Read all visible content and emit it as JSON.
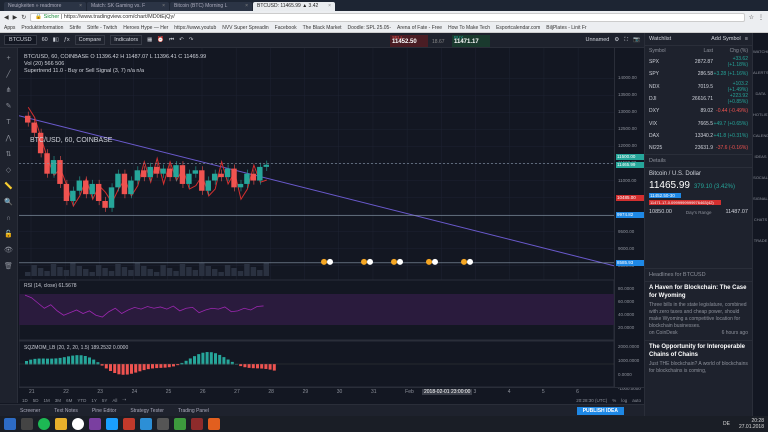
{
  "browser": {
    "tabs": [
      {
        "label": "Neuigkeiten » readmore",
        "active": false
      },
      {
        "label": "Match: SK Gaming vs. F",
        "active": false
      },
      {
        "label": "Bitcoin (BTC) Morning L",
        "active": false
      },
      {
        "label": "BTCUSD: 11465.99 ▲ 3.42",
        "active": true
      }
    ],
    "secure_label": "Sicher",
    "url": "https://www.tradingview.com/chart/MD0tEjQy/",
    "bookmarks": [
      "Apps",
      "Produktinformation",
      "Strife",
      "Strife - Twitch",
      "Heroes Hype — Her",
      "https://www.youtub",
      "NVV Super Spreadin",
      "Facebook",
      "The Black Market",
      "Doodle: SPL 25.05-",
      "Arena of Fate - Free",
      "How To Make Tech",
      "Esportcalendar.com",
      "BiljPlates - Linit Fr"
    ]
  },
  "toolbar": {
    "symbol": "BTCUSD",
    "interval": "60",
    "compare": "Compare",
    "indicators": "Indicators",
    "layout": "Unnamed",
    "sell_label": "SELL",
    "sell_price": "11452.50",
    "spread": "18.67",
    "buy_label": "BUY",
    "buy_price": "11471.17"
  },
  "legend": {
    "ohlc": "BTC/USD, 60, COINBASE O 11396.42 H 11487.07 L 11396.41 C 11465.99",
    "vol": "Vol (20) 566 506",
    "supertrend": "Supertrend 11.0 - Buy or Sell Signal (3, 7) n/a n/a",
    "rsi": "RSI (14, close) 61.5678",
    "sqz": "SQZMOM_LB (20, 2, 20, 1.5) 189.2532 0.0000"
  },
  "chart_title": "BTC/USD, 60, COINBASE",
  "chart_data": {
    "type": "line",
    "title": "BTC/USD, 60, COINBASE",
    "x_ticks": [
      "21",
      "22",
      "23",
      "24",
      "25",
      "26",
      "27",
      "28",
      "29",
      "30",
      "31",
      "Feb",
      "2",
      "3",
      "4",
      "5",
      "6"
    ],
    "x_cursor_label": "2018-02-01 23:00:00",
    "y_ticks": [
      14000,
      13500,
      13000,
      12500,
      12000,
      11500,
      11000,
      10500,
      10000,
      9500,
      9000,
      8500
    ],
    "ylim": [
      8200,
      14300
    ],
    "price_tags": {
      "last": "11465.99",
      "high": "11500.00",
      "supertrend": "10485.00",
      "low": "9974.82",
      "other": "8585.93"
    },
    "close_series": [
      12700,
      12400,
      11800,
      11200,
      11600,
      10900,
      10400,
      10700,
      11000,
      10600,
      10900,
      10400,
      10200,
      10800,
      11200,
      10600,
      11000,
      11300,
      11100,
      11400,
      11200,
      11350,
      11100,
      11450,
      10900,
      11200,
      11300,
      10700,
      11000,
      11200,
      11100,
      11350,
      10800,
      10900,
      11200,
      11000,
      11400,
      11465
    ],
    "trendline": {
      "from_x": 0.0,
      "from_y": 12900,
      "to_x": 1.0,
      "to_y": 8500
    },
    "rsi_ticks": [
      80,
      60,
      40,
      20
    ],
    "sqz_ticks": [
      2000,
      1000,
      0,
      -1000
    ]
  },
  "time_axis_status": {
    "clock": "20:28:30 (UTC)",
    "pct": "%",
    "log": "log",
    "auto": "auto"
  },
  "bottom_tabs": [
    "Screener",
    "Text Notes",
    "Pine Editor",
    "Strategy Tester",
    "Trading Panel"
  ],
  "publish_label": "PUBLISH IDEA",
  "watchlist": {
    "title": "Watchlist",
    "add_symbol": "Add Symbol",
    "columns": [
      "Symbol",
      "Last",
      "Chg (%)"
    ],
    "rows": [
      {
        "symbol": "SPX",
        "last": "2872.87",
        "chg": "+33.62 (+1.18%)",
        "up": true
      },
      {
        "symbol": "SPY",
        "last": "286.58",
        "chg": "+3.28 (+1.16%)",
        "up": true
      },
      {
        "symbol": "NDX",
        "last": "7019.5",
        "chg": "+103.2 (+1.49%)",
        "up": true
      },
      {
        "symbol": "DJI",
        "last": "26616.71",
        "chg": "+223.92 (+0.85%)",
        "up": true
      },
      {
        "symbol": "DXY",
        "last": "89.02",
        "chg": "-0.44 (-0.49%)",
        "up": false
      },
      {
        "symbol": "VIX",
        "last": "7665.5",
        "chg": "+49.7 (+0.65%)",
        "up": true
      },
      {
        "symbol": "DAX",
        "last": "13340.2",
        "chg": "+41.8 (+0.31%)",
        "up": true
      },
      {
        "symbol": "NI225",
        "last": "23631.9",
        "chg": "-37.6 (-0.16%)",
        "up": false
      }
    ]
  },
  "details": {
    "title": "Details",
    "name": "Bitcoin / U.S. Dollar",
    "price": "11465.99",
    "change": "379.10 (3.42%)",
    "bid": "11452.50-30",
    "ask": "11471.17-0.0999999999976463(42)",
    "range_low": "10850.00",
    "range_label": "Day's Range",
    "range_high": "11487.07"
  },
  "headlines": {
    "title": "Headlines for BTCUSD",
    "items": [
      {
        "title": "A Haven for Blockchain: The Case for Wyoming",
        "body": "Three bills in the state legislature, combined with zero taxes and cheap power, should make Wyoming a competitive location for blockchain businesses.",
        "source": "on CoinDesk",
        "age": "6 hours ago"
      },
      {
        "title": "The Opportunity for Interoperable Chains of Chains",
        "body": "Just THE blockchain? A world of blockchains for blockchains is coming,",
        "source": "",
        "age": ""
      }
    ]
  },
  "right_strip": [
    "WATCHLIST",
    "ALERTS",
    "DATA WINDOW",
    "HOTLIST",
    "CALENDAR",
    "IDEAS STREAM",
    "SOCIAL",
    "SIGNALS",
    "CHATS",
    "TRADE"
  ],
  "taskbar": {
    "time": "20:28",
    "date": "27.01.2018",
    "lang": "DE"
  },
  "colors": {
    "bg": "#131722",
    "up": "#26a69a",
    "down": "#ef5350",
    "trend": "#6a5acd",
    "supertrend_red": "#d32f2f",
    "supertrend_green": "#2e7d32",
    "rsi": "#9c27b0"
  }
}
